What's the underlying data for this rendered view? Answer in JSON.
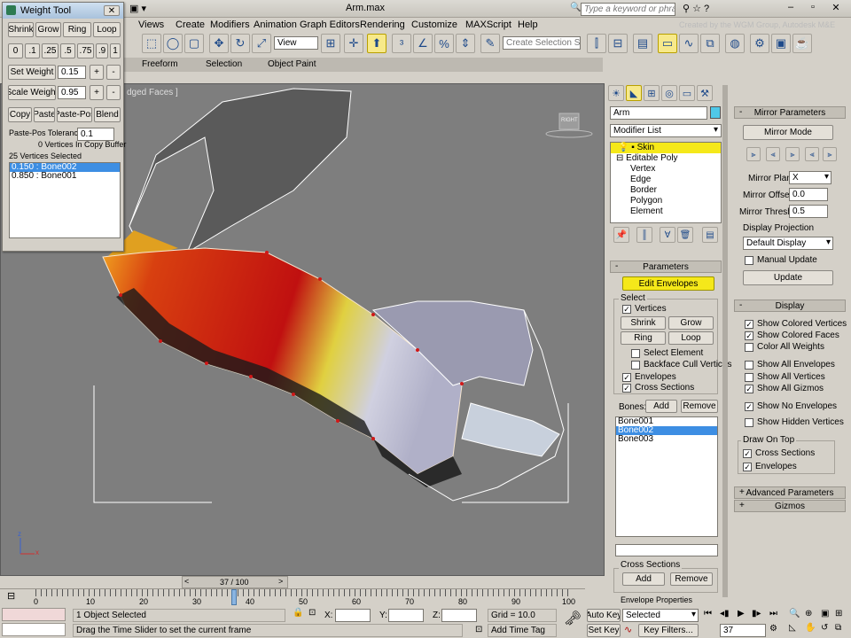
{
  "window": {
    "title": "Arm.max",
    "help_search_placeholder": "Type a keyword or phrase",
    "watermark": "Created by the WGM Group, Autodesk M&E"
  },
  "menubar": [
    "Views",
    "Create",
    "Modifiers",
    "Animation",
    "Graph Editors",
    "Rendering",
    "Customize",
    "MAXScript",
    "Help"
  ],
  "toolbar": {
    "ref_coord": "View",
    "selection_set_placeholder": "Create Selection Se"
  },
  "ribbon_tabs": [
    "Freeform",
    "Selection",
    "Object Paint"
  ],
  "viewport": {
    "label": "dged Faces ]",
    "viewcube_label": "RIGHT",
    "axis_z": "z",
    "axis_x": "x"
  },
  "weight_tool": {
    "title": "Weight Tool",
    "row1": [
      "Shrink",
      "Grow",
      "Ring",
      "Loop"
    ],
    "presets": [
      "0",
      ".1",
      ".25",
      ".5",
      ".75",
      ".9",
      "1"
    ],
    "set_weight_label": "Set Weight",
    "set_weight_value": "0.15",
    "scale_weight_label": "Scale Weight",
    "scale_weight_value": "0.95",
    "plus": "+",
    "minus": "-",
    "row_copy": [
      "Copy",
      "Paste",
      "Paste-Pos",
      "Blend"
    ],
    "paste_tol_label": "Paste-Pos Tolerance",
    "paste_tol_value": "0.1",
    "copy_buffer": "0 Vertices In Copy Buffer",
    "selected": "25 Vertices Selected",
    "bones": [
      "0.150 : Bone002",
      "0.850 : Bone001"
    ]
  },
  "command_panel": {
    "object_name": "Arm",
    "modifier_list": "Modifier List",
    "stack": [
      "Skin",
      "Editable Poly",
      "Vertex",
      "Edge",
      "Border",
      "Polygon",
      "Element"
    ],
    "parameters": {
      "title": "Parameters",
      "edit_envelopes": "Edit Envelopes",
      "select_label": "Select",
      "vertices": "Vertices",
      "shrink": "Shrink",
      "grow": "Grow",
      "ring": "Ring",
      "loop": "Loop",
      "select_element": "Select Element",
      "backface": "Backface Cull Vertices",
      "envelopes": "Envelopes",
      "cross_sections": "Cross Sections",
      "bones_label": "Bones:",
      "add": "Add",
      "remove": "Remove",
      "bones": [
        "Bone001",
        "Bone002",
        "Bone003"
      ],
      "cross_sections_group": "Cross Sections",
      "cs_add": "Add",
      "cs_remove": "Remove",
      "envelope_props": "Envelope Properties"
    }
  },
  "mirror_panel": {
    "title": "Mirror Parameters",
    "mirror_mode": "Mirror Mode",
    "mirror_plane_label": "Mirror Plane:",
    "mirror_plane_value": "X",
    "mirror_offset_label": "Mirror Offset:",
    "mirror_offset_value": "0.0",
    "mirror_thresh_label": "Mirror Thresh.:",
    "mirror_thresh_value": "0.5",
    "display_projection_label": "Display Projection",
    "display_projection_value": "Default Display",
    "manual_update": "Manual Update",
    "update": "Update",
    "display_title": "Display",
    "display_opts": [
      "Show Colored Vertices",
      "Show Colored Faces",
      "Color All Weights",
      "Show All Envelopes",
      "Show All Vertices",
      "Show All Gizmos",
      "Show No Envelopes",
      "Show Hidden Vertices"
    ],
    "draw_on_top": "Draw On Top",
    "dot_cross_sections": "Cross Sections",
    "dot_envelopes": "Envelopes",
    "advanced": "Advanced Parameters",
    "gizmos": "Gizmos"
  },
  "timeline": {
    "frame": "37 / 100",
    "ticks": [
      "0",
      "10",
      "20",
      "30",
      "40",
      "50",
      "60",
      "70",
      "80",
      "90",
      "100"
    ]
  },
  "status": {
    "selected": "1 Object Selected",
    "prompt": "Drag the Time Slider to set the current frame",
    "x_label": "X:",
    "y_label": "Y:",
    "z_label": "Z:",
    "grid": "Grid = 10.0",
    "add_time_tag": "Add Time Tag",
    "auto_key": "Auto Key",
    "set_key": "Set Key",
    "selected_dd": "Selected",
    "key_filters": "Key Filters...",
    "current_frame": "37"
  }
}
